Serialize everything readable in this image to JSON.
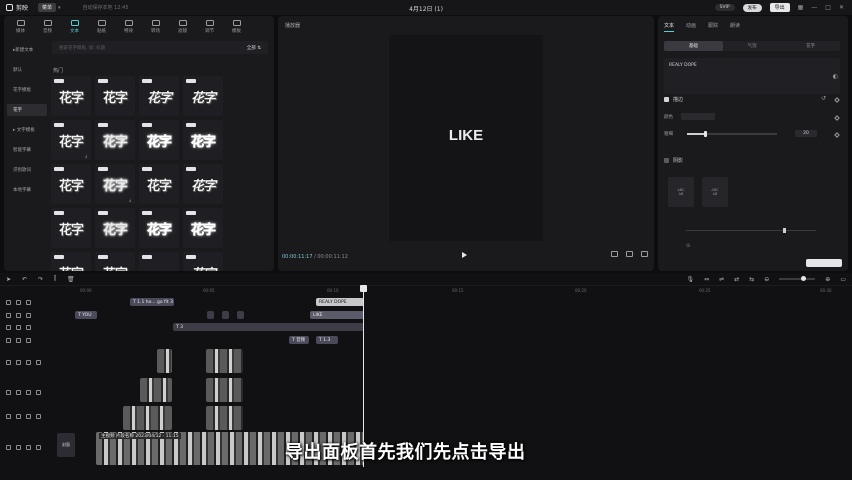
{
  "app": {
    "name": "剪映",
    "menu_label": "菜单",
    "project_status": "自动保存本地 12:45",
    "doc_title": "4月12日 (1)"
  },
  "top_right": {
    "pill1": "SVIP",
    "pill2": "发布",
    "export_label": "导出",
    "icons": [
      "layout-icon",
      "minimize-icon",
      "maximize-icon",
      "close-icon"
    ]
  },
  "tool_tabs": [
    {
      "label": "媒体",
      "active": false
    },
    {
      "label": "音频",
      "active": false
    },
    {
      "label": "文本",
      "active": true
    },
    {
      "label": "贴纸",
      "active": false
    },
    {
      "label": "特效",
      "active": false
    },
    {
      "label": "转场",
      "active": false
    },
    {
      "label": "滤镜",
      "active": false
    },
    {
      "label": "调节",
      "active": false
    },
    {
      "label": "模板",
      "active": false
    }
  ],
  "left_nav": [
    {
      "label": "▸新建文本",
      "active": false
    },
    {
      "label": "默认",
      "active": false
    },
    {
      "label": "花字模板",
      "active": false
    },
    {
      "label": "花字",
      "active": true
    },
    {
      "label": "▸ 文字模板",
      "active": false
    },
    {
      "label": "智能字幕",
      "active": false
    },
    {
      "label": "识别歌词",
      "active": false
    },
    {
      "label": "本地字幕",
      "active": false
    }
  ],
  "search": {
    "placeholder": "搜索花字模板, 如: 标题",
    "right": "全部 ⇅"
  },
  "section_label": "热门",
  "tile_text": "花字",
  "player": {
    "label": "播放器",
    "canvas_text": "LIKE",
    "time_current": "00:00:11:17",
    "time_total": " / 00:00:11:12"
  },
  "inspector": {
    "tabs": [
      {
        "label": "文本",
        "active": false
      },
      {
        "label": "动画",
        "active": false
      },
      {
        "label": "跟踪",
        "active": false
      },
      {
        "label": "朗读",
        "active": false
      }
    ],
    "sub_tabs": [
      {
        "label": "基础",
        "active": true
      },
      {
        "label": "气泡",
        "active": false
      },
      {
        "label": "花字",
        "active": false
      }
    ],
    "text_value": "REALY DOPE",
    "stroke_label": "描边",
    "color_label": "颜色",
    "size_label": "粗细",
    "size_value": "20",
    "size_fraction": 0.2,
    "shadow_label": "阴影",
    "presets": [
      "ABC\nAB",
      "ABC\nAB"
    ]
  },
  "timeline": {
    "ruler": [
      "00:00",
      "00:05",
      "00:10",
      "00:15",
      "00:20",
      "00:25",
      "00:30"
    ],
    "clips": {
      "text_a": "T 1.1 ho... go fit 3",
      "text_b": "REALY DOPE",
      "text_c": "T YOU",
      "text_d": "LIKE",
      "text_e": "T 3",
      "text_f": "T 音频",
      "text_g": "T 1.3",
      "main_video": "主视频  片段名称 2023/04/12 · 11:15",
      "cover": "封面"
    }
  },
  "subtitle": "导出面板首先我们先点击导出",
  "colors": {
    "accent": "#4fd1d9",
    "bg": "#0d0d0f",
    "panel": "#1a1a1d"
  }
}
